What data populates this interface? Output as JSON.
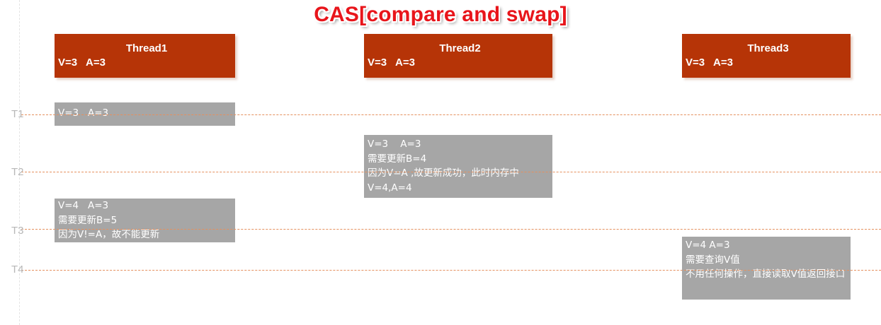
{
  "title": "CAS[compare and swap]",
  "threads": [
    {
      "name": "Thread1",
      "values": "V=3   A=3"
    },
    {
      "name": "Thread2",
      "values": "V=3   A=3"
    },
    {
      "name": "Thread3",
      "values": "V=3   A=3"
    }
  ],
  "time_labels": [
    "T1",
    "T2",
    "T3",
    "T4"
  ],
  "boxes": {
    "t1_thread1": {
      "lines": [
        "V=3   A=3"
      ]
    },
    "t2_thread2": {
      "lines": [
        "V=3    A=3",
        "需要更新B=4",
        "因为V=A ,故更新成功，此时内存中",
        "V=4,A=4"
      ]
    },
    "t3_thread1": {
      "lines": [
        "V=4   A=3",
        "需要更新B=5",
        "因为V!=A，故不能更新"
      ]
    },
    "t4_thread3": {
      "lines": [
        "V=4   A=3",
        "需要查询V值",
        "不用任何操作，直接读取V值返回接口"
      ]
    }
  },
  "colors": {
    "title": "#e8151b",
    "thread_header": "#b63407",
    "gray_box": "#a6a6a6",
    "time_line": "#e5905e",
    "time_label": "#b8b8b8"
  }
}
